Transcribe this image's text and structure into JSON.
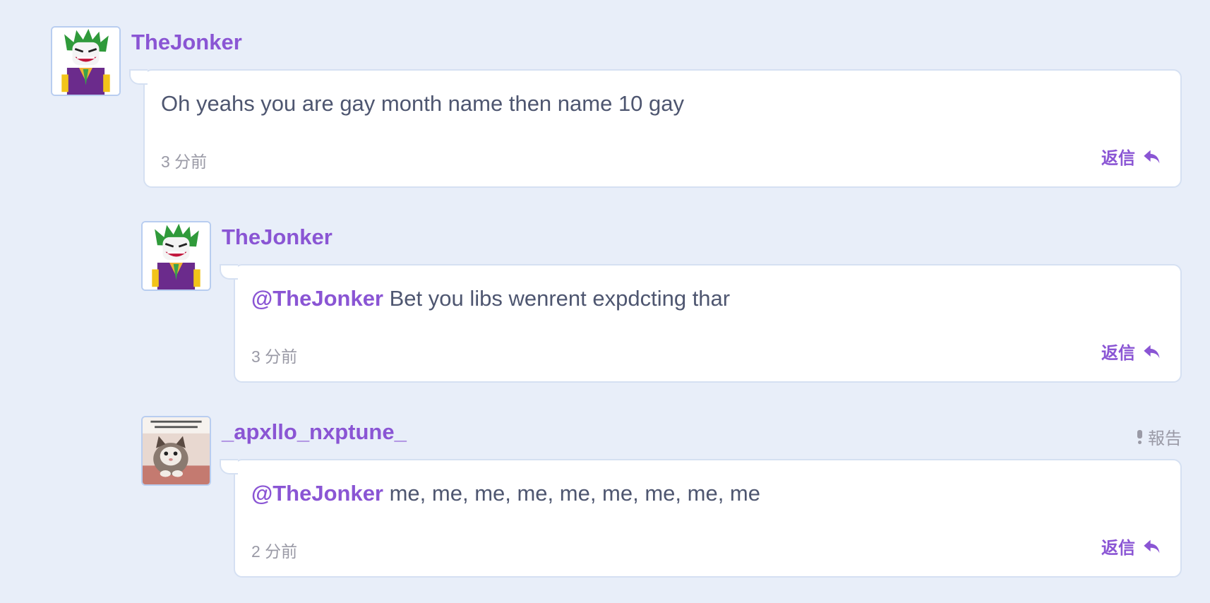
{
  "comments": [
    {
      "username": "TheJonker",
      "avatar_icon": "joker-minifigure-avatar",
      "mention": "",
      "text": "Oh yeahs you are gay month name then name 10 gay",
      "timestamp": "3 分前",
      "reply_label": "返信",
      "report_label": ""
    },
    {
      "username": "TheJonker",
      "avatar_icon": "joker-minifigure-avatar",
      "mention": "@TheJonker",
      "text": " Bet you libs wenrent expdcting thar",
      "timestamp": "3 分前",
      "reply_label": "返信",
      "report_label": ""
    },
    {
      "username": "_apxllo_nxptune_",
      "avatar_icon": "kitten-meme-avatar",
      "mention": "@TheJonker",
      "text": " me, me, me, me, me, me, me, me, me",
      "timestamp": "2 分前",
      "reply_label": "返信",
      "report_label": "報告"
    }
  ],
  "colors": {
    "background": "#e8eef9",
    "accent": "#8a55d4",
    "body_text": "#4e5670",
    "muted_text": "#9a9aa6"
  }
}
